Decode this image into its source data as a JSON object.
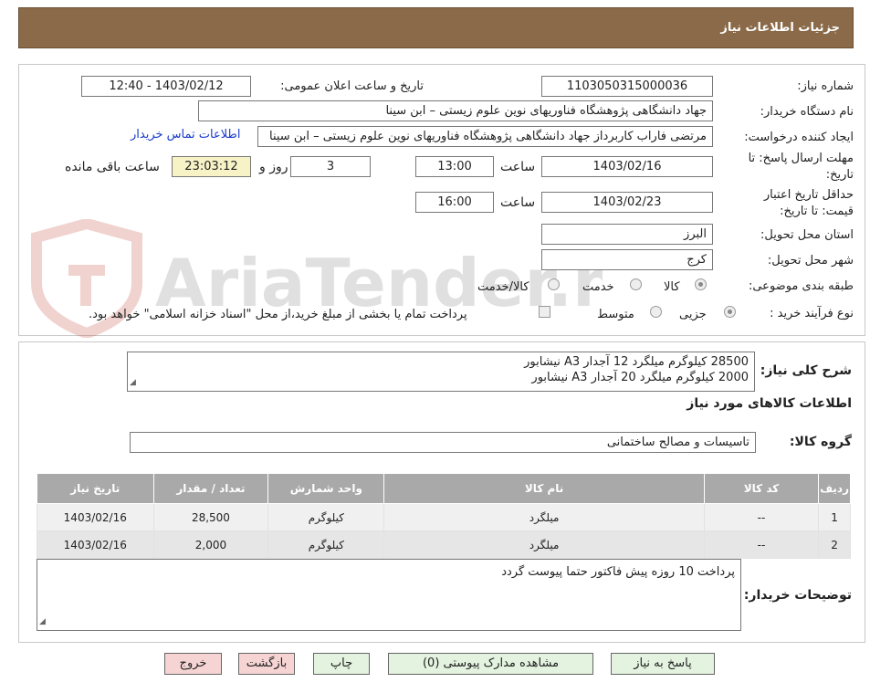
{
  "header": {
    "title": "جزئیات اطلاعات نیاز"
  },
  "need_info": {
    "need_number_label": "شماره نیاز:",
    "need_number": "1103050315000036",
    "announce_label": "تاریخ و ساعت اعلان عمومی:",
    "announce_value": "1403/02/12 - 12:40",
    "buyer_org_label": "نام دستگاه خریدار:",
    "buyer_org": "جهاد دانشگاهی پژوهشگاه فناوریهای نوین علوم زیستی – ابن سینا",
    "requester_label": "ایجاد کننده درخواست:",
    "requester": "مرتضی فاراب کاربرداز جهاد دانشگاهی پژوهشگاه فناوریهای نوین علوم زیستی – ابن سینا",
    "contact_link": "اطلاعات تماس خریدار",
    "deadline_label_1": "مهلت ارسال پاسخ: تا",
    "deadline_label_2": "تاریخ:",
    "deadline_date": "1403/02/16",
    "time_label": "ساعت",
    "deadline_time": "13:00",
    "days_value": "3",
    "days_label": "روز و",
    "remaining_time": "23:03:12",
    "remaining_label": "ساعت باقی مانده",
    "validity_label_1": "حداقل تاریخ اعتبار",
    "validity_label_2": "قیمت: تا تاریخ:",
    "validity_date": "1403/02/23",
    "validity_time_label": "ساعت",
    "validity_time": "16:00",
    "province_label": "استان محل تحویل:",
    "province": "البرز",
    "city_label": "شهر محل تحویل:",
    "city": "کرج",
    "category_label": "طبقه بندی موضوعی:",
    "category_options": [
      "کالا",
      "خدمت",
      "کالا/خدمت"
    ],
    "category_selected": "کالا",
    "process_label": "نوع فرآیند خرید :",
    "process_options": [
      "جزیی",
      "متوسط"
    ],
    "process_selected": "جزیی",
    "treasury_note": "پرداخت تمام یا بخشی از مبلغ خرید،از محل \"اسناد خزانه اسلامی\" خواهد بود."
  },
  "description": {
    "label": "شرح کلی نیاز:",
    "lines": [
      "28500 کیلوگرم میلگرد 12 آجدار A3 نیشابور",
      "2000 کیلوگرم میلگرد 20 آجدار A3 نیشابور"
    ]
  },
  "goods": {
    "section_title": "اطلاعات کالاهای مورد نیاز",
    "group_label": "گروه کالا:",
    "group_value": "تاسیسات و مصالح ساختمانی",
    "columns": [
      "ردیف",
      "کد کالا",
      "نام کالا",
      "واحد شمارش",
      "تعداد / مقدار",
      "تاریخ نیاز"
    ],
    "rows": [
      [
        "1",
        "--",
        "میلگرد",
        "کیلوگرم",
        "28,500",
        "1403/02/16"
      ],
      [
        "2",
        "--",
        "میلگرد",
        "کیلوگرم",
        "2,000",
        "1403/02/16"
      ]
    ]
  },
  "buyer_notes": {
    "label": "توضیحات خریدار:",
    "text": "پرداخت 10 روزه پیش فاکتور حتما پیوست گردد"
  },
  "buttons": {
    "reply": "پاسخ به نیاز",
    "attachments": "مشاهده مدارک پیوستی (0)",
    "print": "چاپ",
    "back": "بازگشت",
    "exit": "خروج"
  },
  "watermark": {
    "text": "AriaTender.neT"
  },
  "colors": {
    "header_bg": "#8a6a48",
    "table_header": "#a9a9a9",
    "button_green": "#e4f3e0",
    "button_pink": "#f6d4d4"
  }
}
